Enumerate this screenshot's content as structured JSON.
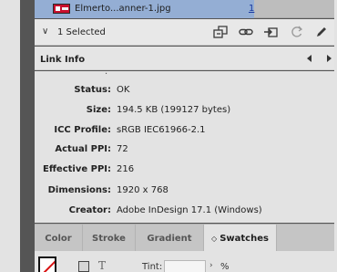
{
  "links_panel": {
    "file": {
      "name": "Elmerto...anner-1.jpg",
      "page": "1"
    },
    "selection": {
      "count_label": "1 Selected"
    },
    "toolbar_icons": [
      "relink-from-cc-icon",
      "relink-icon",
      "go-to-link-icon",
      "update-link-icon",
      "edit-original-icon"
    ]
  },
  "link_info": {
    "title": "Link Info",
    "rows": [
      {
        "label": "Status:",
        "value": "OK"
      },
      {
        "label": "Size:",
        "value": "194.5 KB (199127 bytes)"
      },
      {
        "label": "ICC Profile:",
        "value": "sRGB IEC61966-2.1"
      },
      {
        "label": "Actual PPI:",
        "value": "72"
      },
      {
        "label": "Effective PPI:",
        "value": "216"
      },
      {
        "label": "Dimensions:",
        "value": "1920 x 768"
      },
      {
        "label": "Creator:",
        "value": "Adobe InDesign 17.1 (Windows)"
      }
    ]
  },
  "tabs": {
    "items": [
      {
        "label": "Color"
      },
      {
        "label": "Stroke"
      },
      {
        "label": "Gradient"
      },
      {
        "label": "Swatches",
        "prefix": "◇"
      }
    ],
    "active": "Swatches"
  },
  "swatches_bar": {
    "tint_label": "Tint:",
    "tint_value": "",
    "tint_unit": "%"
  },
  "colors": {
    "selection_highlight": "#94aed4",
    "panel_bg": "#e3e3e3",
    "link_page_color": "#1a3aa0",
    "none_swatch_slash": "#d81010"
  }
}
